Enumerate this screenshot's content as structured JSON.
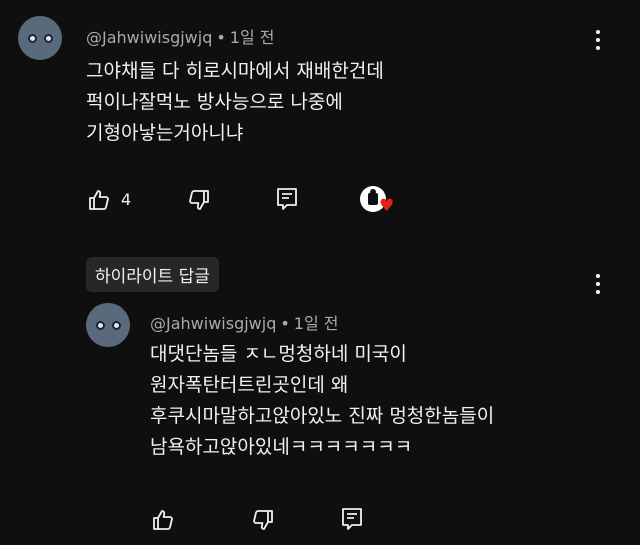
{
  "comment": {
    "username": "@Jahwiwisgjwjq",
    "separator": "•",
    "time": "1일 전",
    "lines": [
      "그야채들 다 히로시마에서 재배한건데",
      "퍽이나잘먹노 방사능으로 나중에",
      "기형아낳는거아니냐"
    ],
    "like_count": "4"
  },
  "highlight_label": "하이라이트 답글",
  "reply": {
    "username": "@Jahwiwisgjwjq",
    "separator": "•",
    "time": "1일 전",
    "lines": [
      "대댓단놈들 ㅈㄴ멍청하네 미국이",
      "원자폭탄터트린곳인데 왜",
      "후쿠시마말하고앉아있노 진짜 멍청한놈들이",
      "남욕하고앉아있네ㅋㅋㅋㅋㅋㅋㅋ"
    ]
  },
  "icons": {
    "like": "thumbs-up-icon",
    "dislike": "thumbs-down-icon",
    "reply": "reply-icon",
    "more": "more-vert-icon",
    "creator_heart": "creator-heart-icon"
  },
  "colors": {
    "background": "#0f0f0f",
    "text": "#f1f1f1",
    "muted": "#aaaaaa",
    "heart": "#e62117",
    "chip": "#272727"
  }
}
